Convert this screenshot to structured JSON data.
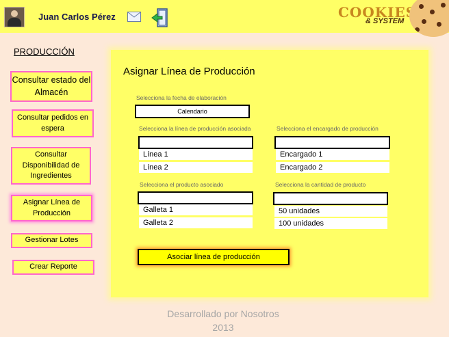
{
  "header": {
    "user_name": "Juan Carlos Pérez",
    "logo_line1": "COOKIES",
    "logo_line2": "& SYSTEM"
  },
  "sidebar": {
    "section_title": "PRODUCCIÓN",
    "items": [
      {
        "label": "Consultar estado del Almacén"
      },
      {
        "label": "Consultar pedidos en espera"
      },
      {
        "label": "Consultar Disponibilidad de Ingredientes"
      },
      {
        "label": "Asignar Línea de Producción",
        "active": true
      },
      {
        "label": "Gestionar Lotes"
      },
      {
        "label": "Crear Reporte"
      }
    ]
  },
  "main": {
    "title": "Asignar Línea de Producción",
    "date_label": "Selecciona la fecha de elaboración",
    "date_value": "Calendario",
    "line_label": "Selecciona la línea de producción asociada",
    "line_options": [
      "Línea 1",
      "Línea 2"
    ],
    "manager_label": "Selecciona el encargado de producción",
    "manager_options": [
      "Encargado 1",
      "Encargado 2"
    ],
    "product_label": "Selecciona el producto asociado",
    "product_options": [
      "Galleta 1",
      "Galleta 2"
    ],
    "quantity_label": "Selecciona la cantidad de producto",
    "quantity_options": [
      "50 unidades",
      "100 unidades"
    ],
    "submit_label": "Asociar línea de producción"
  },
  "footer": {
    "line1": "Desarrollado por Nosotros",
    "line2": "2013"
  },
  "colors": {
    "accent_yellow": "#ffff66",
    "button_border_pink": "#ff66cc",
    "background": "#fde9d9"
  },
  "icons": [
    "user-avatar",
    "mail-icon",
    "exit-door-icon",
    "cookie-logo"
  ]
}
